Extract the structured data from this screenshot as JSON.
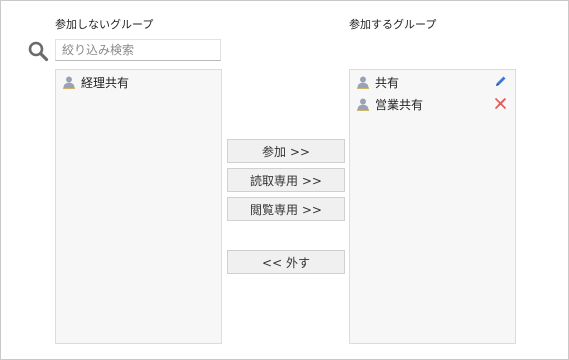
{
  "left_panel": {
    "title": "参加しないグループ",
    "search": {
      "placeholder": "絞り込み検索",
      "value": ""
    },
    "items": [
      {
        "label": "経理共有",
        "icon": "user-group-icon"
      }
    ]
  },
  "right_panel": {
    "title": "参加するグループ",
    "items": [
      {
        "label": "共有",
        "icon": "user-group-icon",
        "permission_icon": "pen-icon",
        "permission_color": "#3b78d8"
      },
      {
        "label": "営業共有",
        "icon": "user-group-icon",
        "permission_icon": "pen-disabled-icon",
        "permission_color": "#e05a5a"
      }
    ]
  },
  "actions": {
    "join_label": "参加 >>",
    "readonly_label": "読取専用 >>",
    "viewonly_label": "閲覧専用 >>",
    "remove_label": "<< 外す"
  },
  "colors": {
    "border": "#c9c9c9",
    "list_bg": "#f7f7f7",
    "button_bg": "#f0f0f0",
    "icon_gray": "#8a8f99"
  }
}
